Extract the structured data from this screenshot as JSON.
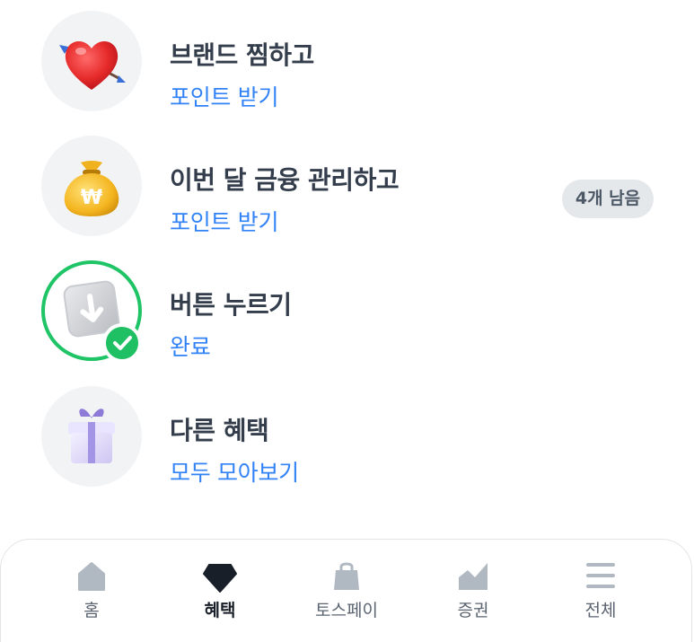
{
  "benefits": [
    {
      "title": "브랜드 찜하고",
      "subtitle": "포인트 받기",
      "icon": "heart-arrow-icon"
    },
    {
      "title": "이번 달 금융 관리하고",
      "subtitle": "포인트 받기",
      "icon": "money-bag-icon",
      "badge": "4개 남음"
    },
    {
      "title": "버튼 누르기",
      "subtitle": "완료",
      "icon": "download-key-icon",
      "status": "completed"
    },
    {
      "title": "다른 혜택",
      "subtitle": "모두 모아보기",
      "icon": "gift-box-icon"
    }
  ],
  "tabs": [
    {
      "label": "홈",
      "icon": "home-icon",
      "active": false
    },
    {
      "label": "혜택",
      "icon": "diamond-icon",
      "active": true
    },
    {
      "label": "토스페이",
      "icon": "shopping-bag-icon",
      "active": false
    },
    {
      "label": "증권",
      "icon": "stock-chart-icon",
      "active": false
    },
    {
      "label": "전체",
      "icon": "menu-icon",
      "active": false
    }
  ],
  "colors": {
    "title": "#333d4b",
    "link": "#3182f6",
    "success": "#1fc466",
    "badge_bg": "#e5e8eb",
    "tab_icon": "#b0b8c1",
    "tab_active_icon": "#191f28"
  }
}
